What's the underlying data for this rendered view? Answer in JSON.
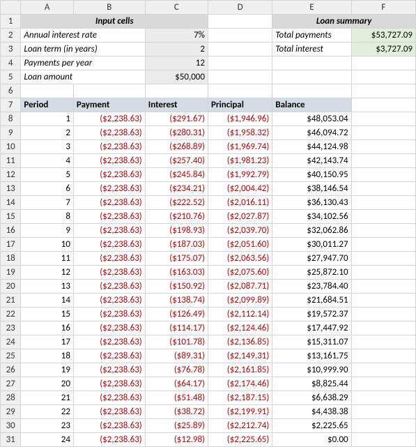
{
  "columns": [
    "A",
    "B",
    "C",
    "D",
    "E",
    "F"
  ],
  "rows_count": 31,
  "headers": {
    "input_cells": "Input cells",
    "loan_summary": "Loan summary"
  },
  "inputs": {
    "rate_label": "Annual interest rate",
    "rate_value": "7%",
    "term_label": "Loan term (in years)",
    "term_value": "2",
    "ppy_label": "Payments per year",
    "ppy_value": "12",
    "amount_label": "Loan amount",
    "amount_value": "$50,000"
  },
  "summary": {
    "total_payments_label": "Total payments",
    "total_payments_value": "$53,727.09",
    "total_interest_label": "Total interest",
    "total_interest_value": "$3,727.09"
  },
  "table_headers": {
    "period": "Period",
    "payment": "Payment",
    "interest": "Interest",
    "principal": "Principal",
    "balance": "Balance"
  },
  "schedule": [
    {
      "period": "1",
      "payment": "($2,238.63)",
      "interest": "($291.67)",
      "principal": "($1,946.96)",
      "balance": "$48,053.04"
    },
    {
      "period": "2",
      "payment": "($2,238.63)",
      "interest": "($280.31)",
      "principal": "($1,958.32)",
      "balance": "$46,094.72"
    },
    {
      "period": "3",
      "payment": "($2,238.63)",
      "interest": "($268.89)",
      "principal": "($1,969.74)",
      "balance": "$44,124.98"
    },
    {
      "period": "4",
      "payment": "($2,238.63)",
      "interest": "($257.40)",
      "principal": "($1,981.23)",
      "balance": "$42,143.74"
    },
    {
      "period": "5",
      "payment": "($2,238.63)",
      "interest": "($245.84)",
      "principal": "($1,992.79)",
      "balance": "$40,150.95"
    },
    {
      "period": "6",
      "payment": "($2,238.63)",
      "interest": "($234.21)",
      "principal": "($2,004.42)",
      "balance": "$38,146.54"
    },
    {
      "period": "7",
      "payment": "($2,238.63)",
      "interest": "($222.52)",
      "principal": "($2,016.11)",
      "balance": "$36,130.43"
    },
    {
      "period": "8",
      "payment": "($2,238.63)",
      "interest": "($210.76)",
      "principal": "($2,027.87)",
      "balance": "$34,102.56"
    },
    {
      "period": "9",
      "payment": "($2,238.63)",
      "interest": "($198.93)",
      "principal": "($2,039.70)",
      "balance": "$32,062.86"
    },
    {
      "period": "10",
      "payment": "($2,238.63)",
      "interest": "($187.03)",
      "principal": "($2,051.60)",
      "balance": "$30,011.27"
    },
    {
      "period": "11",
      "payment": "($2,238.63)",
      "interest": "($175.07)",
      "principal": "($2,063.56)",
      "balance": "$27,947.70"
    },
    {
      "period": "12",
      "payment": "($2,238.63)",
      "interest": "($163.03)",
      "principal": "($2,075.60)",
      "balance": "$25,872.10"
    },
    {
      "period": "13",
      "payment": "($2,238.63)",
      "interest": "($150.92)",
      "principal": "($2,087.71)",
      "balance": "$23,784.40"
    },
    {
      "period": "14",
      "payment": "($2,238.63)",
      "interest": "($138.74)",
      "principal": "($2,099.89)",
      "balance": "$21,684.51"
    },
    {
      "period": "15",
      "payment": "($2,238.63)",
      "interest": "($126.49)",
      "principal": "($2,112.14)",
      "balance": "$19,572.37"
    },
    {
      "period": "16",
      "payment": "($2,238.63)",
      "interest": "($114.17)",
      "principal": "($2,124.46)",
      "balance": "$17,447.92"
    },
    {
      "period": "17",
      "payment": "($2,238.63)",
      "interest": "($101.78)",
      "principal": "($2,136.85)",
      "balance": "$15,311.07"
    },
    {
      "period": "18",
      "payment": "($2,238.63)",
      "interest": "($89.31)",
      "principal": "($2,149.31)",
      "balance": "$13,161.75"
    },
    {
      "period": "19",
      "payment": "($2,238.63)",
      "interest": "($76.78)",
      "principal": "($2,161.85)",
      "balance": "$10,999.90"
    },
    {
      "period": "20",
      "payment": "($2,238.63)",
      "interest": "($64.17)",
      "principal": "($2,174.46)",
      "balance": "$8,825.44"
    },
    {
      "period": "21",
      "payment": "($2,238.63)",
      "interest": "($51.48)",
      "principal": "($2,187.15)",
      "balance": "$6,638.29"
    },
    {
      "period": "22",
      "payment": "($2,238.63)",
      "interest": "($38.72)",
      "principal": "($2,199.91)",
      "balance": "$4,438.38"
    },
    {
      "period": "23",
      "payment": "($2,238.63)",
      "interest": "($25.89)",
      "principal": "($2,212.74)",
      "balance": "$2,225.65"
    },
    {
      "period": "24",
      "payment": "($2,238.63)",
      "interest": "($12.98)",
      "principal": "($2,225.65)",
      "balance": "$0.00"
    }
  ]
}
